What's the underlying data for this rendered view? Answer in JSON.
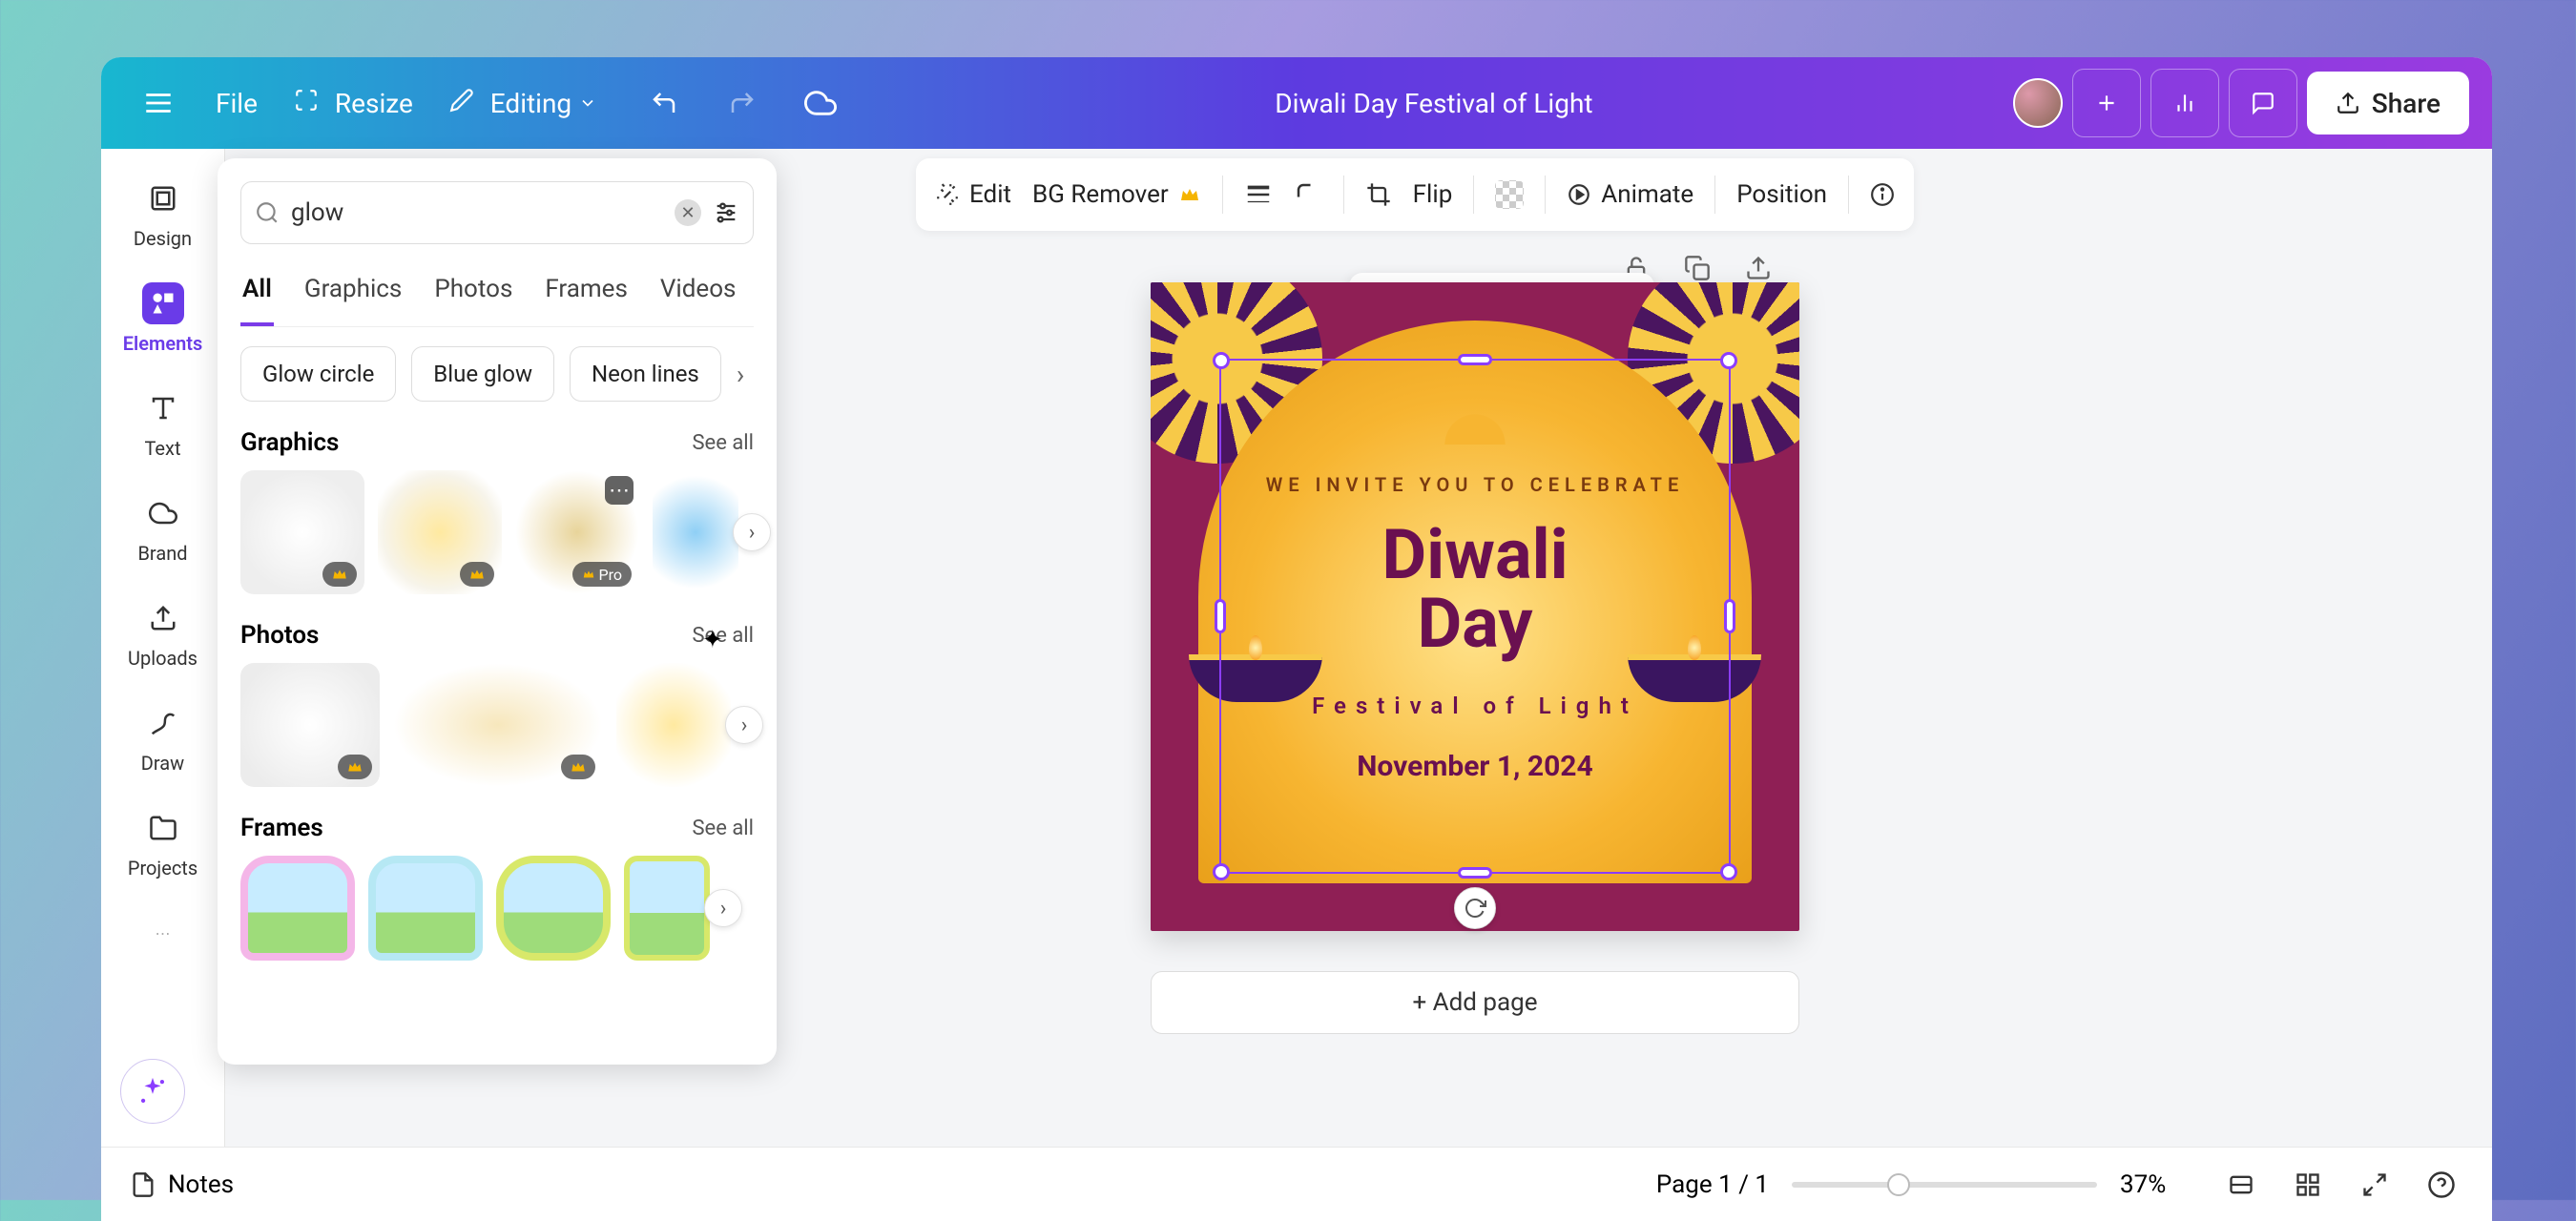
{
  "topbar": {
    "file": "File",
    "resize": "Resize",
    "editing": "Editing",
    "title": "Diwali Day Festival of Light",
    "share": "Share"
  },
  "rail": {
    "items": [
      {
        "label": "Design"
      },
      {
        "label": "Elements"
      },
      {
        "label": "Text"
      },
      {
        "label": "Brand"
      },
      {
        "label": "Uploads"
      },
      {
        "label": "Draw"
      },
      {
        "label": "Projects"
      }
    ]
  },
  "panel": {
    "search_value": "glow",
    "tabs": [
      "All",
      "Graphics",
      "Photos",
      "Frames",
      "Videos"
    ],
    "chips": [
      "Glow circle",
      "Blue glow",
      "Neon lines"
    ],
    "sections": {
      "graphics": {
        "title": "Graphics",
        "see_all": "See all",
        "pro_label": "Pro"
      },
      "photos": {
        "title": "Photos",
        "see_all": "See all"
      },
      "frames": {
        "title": "Frames",
        "see_all": "See all"
      }
    }
  },
  "ctx": {
    "edit": "Edit",
    "bg_remover": "BG Remover",
    "flip": "Flip",
    "animate": "Animate",
    "position": "Position"
  },
  "canvas": {
    "invite": "WE INVITE YOU TO CELEBRATE",
    "title_line1": "Diwali",
    "title_line2": "Day",
    "subtitle": "Festival of Light",
    "date": "November 1, 2024",
    "add_page": "+ Add page"
  },
  "footer": {
    "notes": "Notes",
    "page_indicator": "Page 1 / 1",
    "zoom": "37%"
  },
  "colors": {
    "accent": "#8b3dff",
    "maroon": "#8f1f55",
    "gold": "#f7b531"
  }
}
